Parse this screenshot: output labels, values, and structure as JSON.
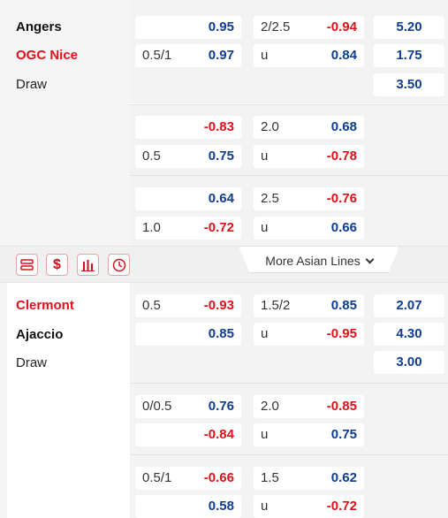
{
  "matches": [
    {
      "home": "Angers",
      "away": "OGC Nice",
      "draw": "Draw",
      "lines": [
        {
          "ah_line": "",
          "ah_home": "0.95",
          "ou_line": "2/2.5",
          "ou_over": "-0.94",
          "x12_home": "5.20",
          "ah_line2": "0.5/1",
          "ah_away": "0.97",
          "ou_label": "u",
          "ou_under": "0.84",
          "x12_away": "1.75",
          "x12_draw": "3.50"
        },
        {
          "ah_line": "",
          "ah_home": "-0.83",
          "ou_line": "2.0",
          "ou_over": "0.68",
          "ah_line2": "0.5",
          "ah_away": "0.75",
          "ou_label": "u",
          "ou_under": "-0.78"
        },
        {
          "ah_line": "",
          "ah_home": "0.64",
          "ou_line": "2.5",
          "ou_over": "-0.76",
          "ah_line2": "1.0",
          "ah_away": "-0.72",
          "ou_label": "u",
          "ou_under": "0.66"
        }
      ]
    },
    {
      "home": "Clermont",
      "away": "Ajaccio",
      "draw": "Draw",
      "lines": [
        {
          "ah_line": "0.5",
          "ah_home": "-0.93",
          "ou_line": "1.5/2",
          "ou_over": "0.85",
          "x12_home": "2.07",
          "ah_line2": "",
          "ah_away": "0.85",
          "ou_label": "u",
          "ou_under": "-0.95",
          "x12_away": "4.30",
          "x12_draw": "3.00"
        },
        {
          "ah_line": "0/0.5",
          "ah_home": "0.76",
          "ou_line": "2.0",
          "ou_over": "-0.85",
          "ah_line2": "",
          "ah_away": "-0.84",
          "ou_label": "u",
          "ou_under": "0.75"
        },
        {
          "ah_line": "0.5/1",
          "ah_home": "-0.66",
          "ou_line": "1.5",
          "ou_over": "0.62",
          "ah_line2": "",
          "ah_away": "0.58",
          "ou_label": "u",
          "ou_under": "-0.72"
        }
      ]
    }
  ],
  "toolbar": {
    "icons": [
      "list-icon",
      "dollar-icon",
      "bar-chart-icon",
      "clock-icon"
    ],
    "more_label": "More Asian Lines"
  },
  "colors": {
    "positive": "#0f3d91",
    "negative": "#e0101a",
    "team_highlight": "#e0101a"
  }
}
